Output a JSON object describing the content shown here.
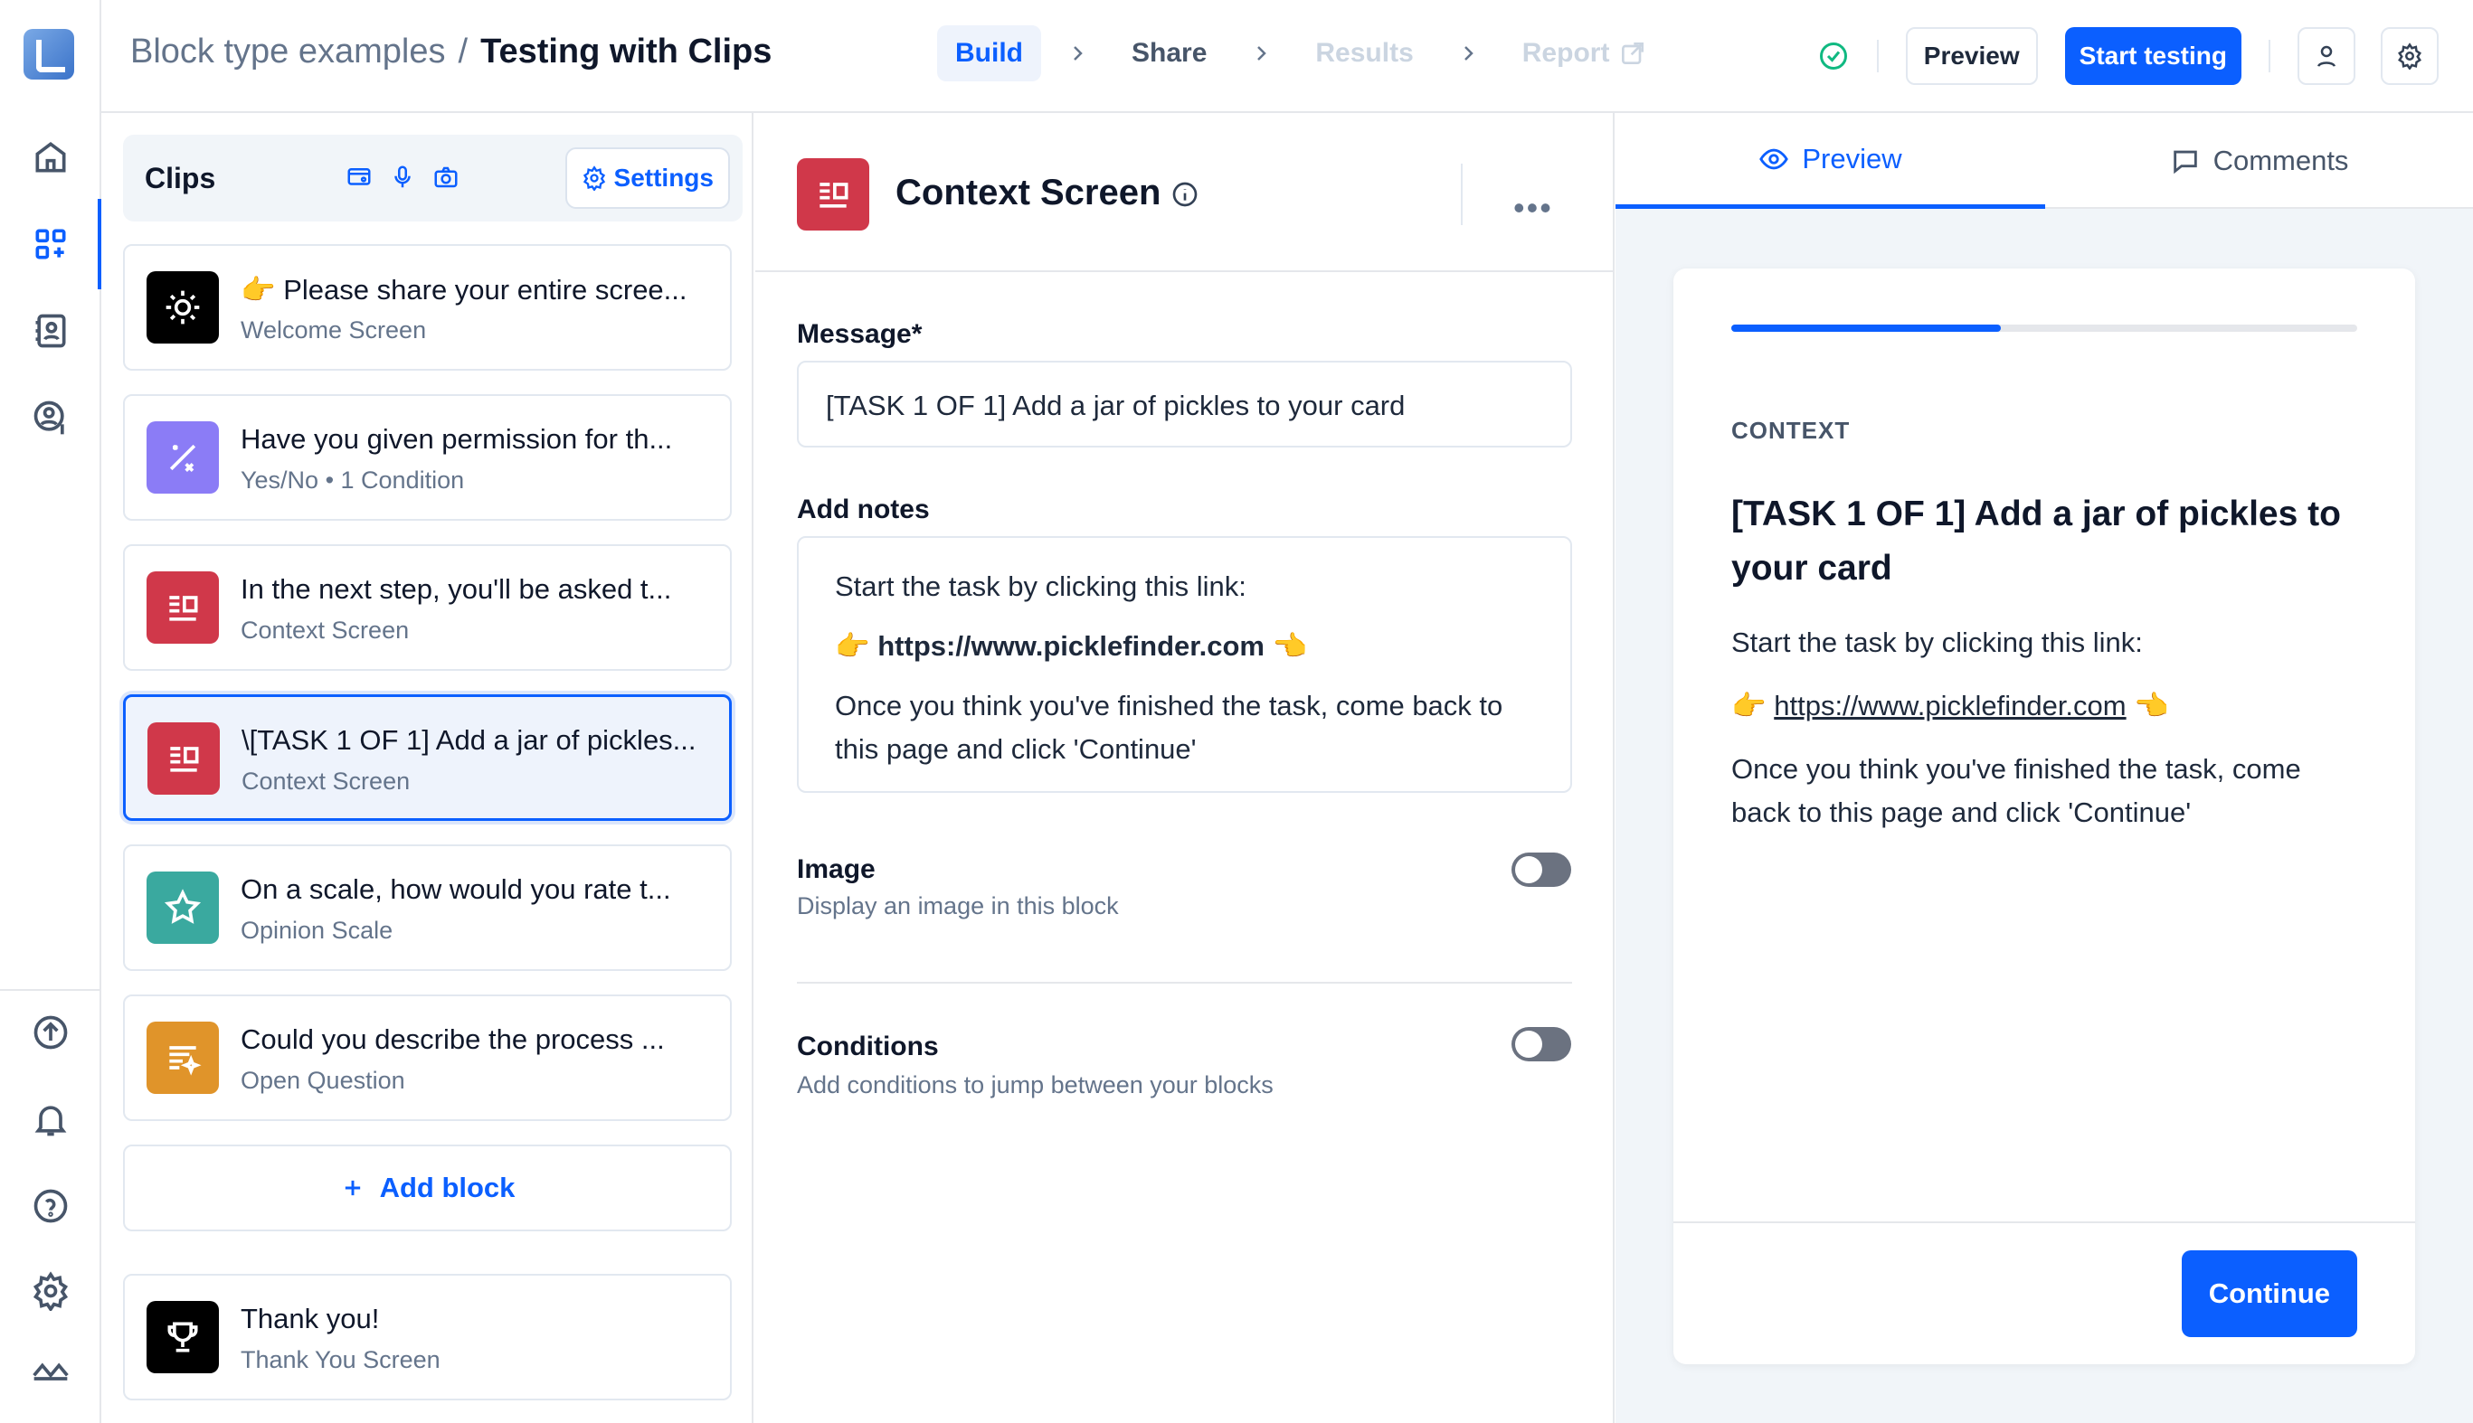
{
  "header": {
    "breadcrumb_parent": "Block type examples",
    "breadcrumb_separator": "/",
    "breadcrumb_current": "Testing with Clips",
    "steps": [
      "Build",
      "Share",
      "Results",
      "Report"
    ],
    "preview_label": "Preview",
    "start_testing_label": "Start testing"
  },
  "clips": {
    "title": "Clips",
    "settings_label": "Settings"
  },
  "blocks": [
    {
      "emoji": "👉",
      "title": "Please share your entire scree...",
      "subtitle": "Welcome Screen",
      "icon": "sun-icon",
      "color": "#000000"
    },
    {
      "title": "Have you given permission for th...",
      "subtitle": "Yes/No • 1 Condition",
      "icon": "percent-icon",
      "color": "#8b7cf6"
    },
    {
      "title": "In the next step, you'll be asked t...",
      "subtitle": "Context Screen",
      "icon": "context-icon",
      "color": "#d0384a"
    },
    {
      "title": "\\[TASK 1 OF 1] Add a jar of pickles...",
      "subtitle": "Context Screen",
      "icon": "context-icon",
      "color": "#d0384a",
      "selected": true
    },
    {
      "title": "On a scale, how would you rate t...",
      "subtitle": "Opinion Scale",
      "icon": "star-icon",
      "color": "#3aa99f"
    },
    {
      "title": "Could you describe the process ...",
      "subtitle": "Open Question",
      "icon": "text-sparkle-icon",
      "color": "#e0942a"
    }
  ],
  "add_block_label": "Add block",
  "thank_you": {
    "title": "Thank you!",
    "subtitle": "Thank You Screen",
    "icon": "trophy-icon",
    "color": "#000000"
  },
  "editor": {
    "block_type": "Context Screen",
    "more_label": "•••",
    "message_label": "Message*",
    "message_value": "[TASK 1 OF 1] Add a jar of pickles to your card",
    "notes_label": "Add notes",
    "notes_line1": "Start the task by clicking this link:",
    "notes_link_prefix": "👉",
    "notes_link": "https://www.picklefinder.com",
    "notes_link_suffix": "👈",
    "notes_line3": "Once you think you've finished the task, come back to this page and click 'Continue'",
    "image_label": "Image",
    "image_desc": "Display an image in this block",
    "conditions_label": "Conditions",
    "conditions_desc": "Add conditions to jump between your blocks"
  },
  "preview": {
    "tab_preview": "Preview",
    "tab_comments": "Comments",
    "progress": 0.43,
    "context_label": "CONTEXT",
    "title": "[TASK 1 OF 1] Add a jar of pickles to your card",
    "body_line1": "Start the task by clicking this link:",
    "link_prefix": "👉",
    "link": "https://www.picklefinder.com",
    "link_suffix": "👈",
    "body_line3": "Once you think you've finished the task, come back to this page and click 'Continue'",
    "continue_label": "Continue"
  }
}
